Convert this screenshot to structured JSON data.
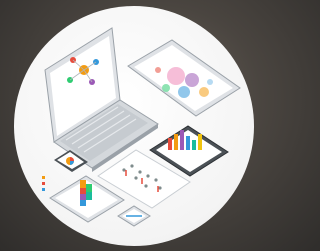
{
  "scene": {
    "background_color": "#4a4540",
    "circle_color": "#f4f4f4",
    "device_colors": {
      "body": "#dfe2e6",
      "edge": "#9aa1a8",
      "screen": "#ffffff",
      "dark": "#4b5156"
    },
    "accents": [
      "#f39c12",
      "#e74c3c",
      "#9b59b6",
      "#3498db",
      "#1abc9c",
      "#2ecc71",
      "#f1c40f"
    ],
    "icons": [
      "laptop-icon",
      "tablet-icon",
      "phone-icon",
      "bar-chart-icon",
      "pie-chart-icon",
      "scatter-chart-icon",
      "mindmap-icon"
    ]
  }
}
